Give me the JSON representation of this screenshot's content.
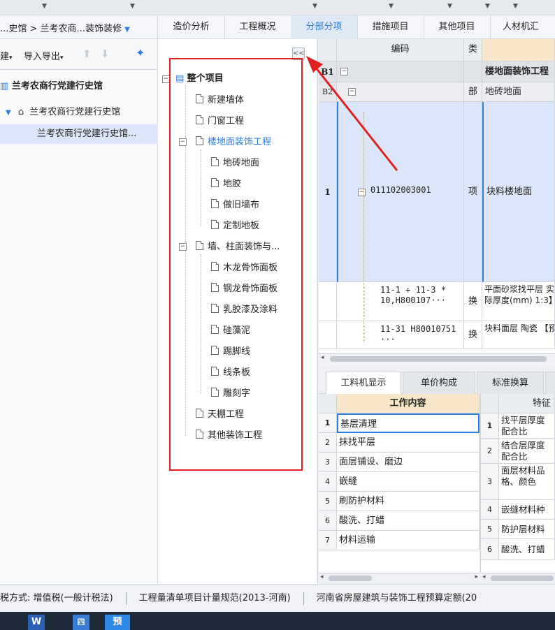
{
  "breadcrumb": {
    "text": "...史馆 > 兰考农商...装饰装修",
    "dropdown_icon": "triangle-down-icon"
  },
  "main_tabs": [
    {
      "label": "造价分析"
    },
    {
      "label": "工程概况"
    },
    {
      "label": "分部分项",
      "active": true
    },
    {
      "label": "措施项目"
    },
    {
      "label": "其他项目"
    },
    {
      "label": "人材机汇"
    }
  ],
  "left_toolbar": {
    "new_label": "建",
    "import_export_label": "导入导出",
    "pin_icon": "pin-icon"
  },
  "left_tree": [
    {
      "label": "兰考农商行党建行史馆",
      "level": 0
    },
    {
      "label": "兰考农商行党建行史馆",
      "level": 1
    },
    {
      "label": "兰考农商行党建行史馆...",
      "level": 2,
      "selected": true
    }
  ],
  "section_tree": {
    "collapse_label": "<<",
    "root": "整个项目",
    "items": [
      {
        "label": "新建墙体"
      },
      {
        "label": "门窗工程"
      },
      {
        "label": "楼地面装饰工程",
        "selected": true
      },
      {
        "label": "地砖地面"
      },
      {
        "label": "地胶"
      },
      {
        "label": "做旧墙布"
      },
      {
        "label": "定制地板"
      },
      {
        "label": "墙、柱面装饰与..."
      },
      {
        "label": "木龙骨饰面板"
      },
      {
        "label": "钢龙骨饰面板"
      },
      {
        "label": "乳胶漆及涂料"
      },
      {
        "label": "硅藻泥"
      },
      {
        "label": "踢脚线"
      },
      {
        "label": "线条板"
      },
      {
        "label": "雕刻字"
      },
      {
        "label": "天棚工程"
      },
      {
        "label": "其他装饰工程"
      }
    ]
  },
  "grid": {
    "headers": {
      "code": "编码",
      "type": "类别"
    },
    "rows": [
      {
        "no": "B1",
        "code": "",
        "type": "",
        "name": "楼地面装饰工程"
      },
      {
        "no": "B2",
        "code": "",
        "type": "部",
        "name": "地砖地面"
      },
      {
        "no": "1",
        "code": "011102003001",
        "type": "项",
        "name": "块料楼地面"
      },
      {
        "no": "",
        "code": "11-1 + 11-3 * 10,H800107···",
        "type": "换",
        "name": "平面砂浆找平层 实际厚度(mm) 1:3】"
      },
      {
        "no": "",
        "code": "11-31 H80010751 ···",
        "type": "换",
        "name": "块料面层 陶瓷 【预拌水泥砂浆"
      }
    ]
  },
  "lower_tabs": [
    {
      "label": "工料机显示"
    },
    {
      "label": "单价构成"
    },
    {
      "label": "标准换算"
    }
  ],
  "work_content": {
    "header": "工作内容",
    "rows": [
      "基层清理",
      "抹找平层",
      "面层铺设、磨边",
      "嵌缝",
      "刷防护材料",
      "酸洗、打蜡",
      "材料运输"
    ]
  },
  "features": {
    "header": "特征",
    "rows": [
      "找平层厚度 配合比",
      "结合层厚度 配合比",
      "面层材料品 格、颜色",
      "嵌缝材料种",
      "防护层材料",
      "酸洗、打蜡"
    ]
  },
  "status_bar": {
    "tax": "税方式: 增值税(一般计税法)",
    "spec": "工程量清单项目计量规范(2013-河南)",
    "quota": "河南省房屋建筑与装饰工程预算定额(20"
  },
  "taskbar": {
    "word": "W",
    "app2": "四",
    "app3": "预"
  },
  "colors": {
    "accent": "#2a7de1",
    "annotation": "#e02020",
    "selection": "#dbe7f8"
  }
}
